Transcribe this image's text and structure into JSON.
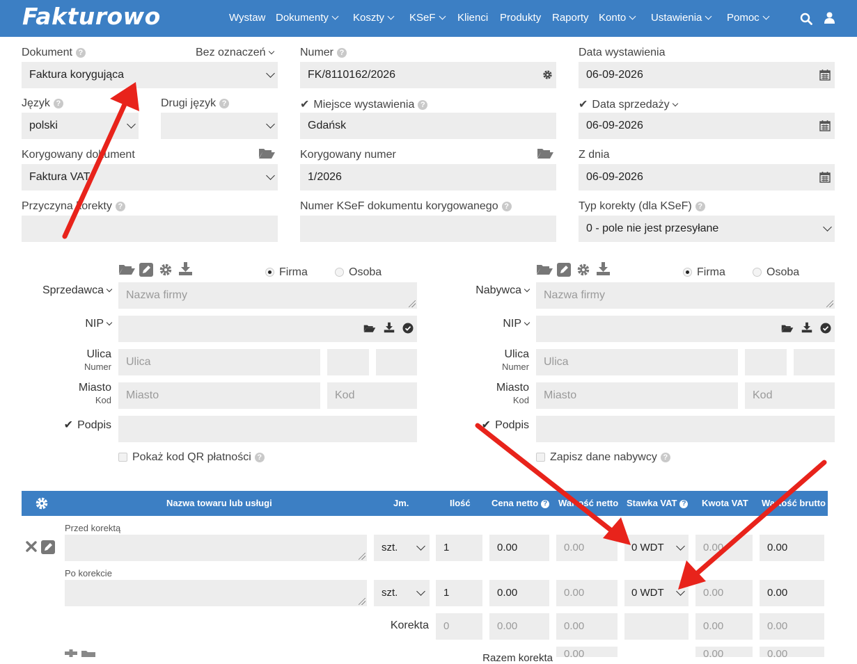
{
  "app": {
    "logo": "Fakturowo"
  },
  "nav": {
    "items": [
      "Wystaw",
      "Dokumenty",
      "Koszty",
      "KSeF",
      "Klienci",
      "Produkty",
      "Raporty",
      "Konto",
      "Ustawienia",
      "Pomoc"
    ]
  },
  "header": {
    "dokument_label": "Dokument",
    "bez_oznaczen": "Bez oznaczeń",
    "dokument_value": "Faktura korygująca",
    "numer_label": "Numer",
    "numer_value": "FK/8110162/2026",
    "data_wyst_label": "Data wystawienia",
    "data_wyst_value": "06-09-2026",
    "jezyk_label": "Język",
    "jezyk_value": "polski",
    "drugi_jezyk_label": "Drugi język",
    "drugi_jezyk_value": "",
    "miejsce_label": "Miejsce wystawienia",
    "miejsce_value": "Gdańsk",
    "data_sprz_label": "Data sprzedaży",
    "data_sprz_value": "06-09-2026",
    "kor_dok_label": "Korygowany dokument",
    "kor_dok_value": "Faktura VAT",
    "kor_num_label": "Korygowany numer",
    "kor_num_value": "1/2026",
    "z_dnia_label": "Z dnia",
    "z_dnia_value": "06-09-2026",
    "przyczyna_label": "Przyczyna korekty",
    "przyczyna_value": "",
    "ksef_num_label": "Numer KSeF dokumentu korygowanego",
    "ksef_num_value": "",
    "typ_kor_label": "Typ korekty (dla KSeF)",
    "typ_kor_value": "0 - pole nie jest przesyłane"
  },
  "seller": {
    "title": "Sprzedawca",
    "firma": "Firma",
    "osoba": "Osoba",
    "nazwa_ph": "Nazwa firmy",
    "nip": "NIP",
    "ulica": "Ulica",
    "numer": "Numer",
    "ulica_ph": "Ulica",
    "miasto": "Miasto",
    "kod": "Kod",
    "miasto_ph": "Miasto",
    "kod_ph": "Kod",
    "podpis": "Podpis",
    "qr": "Pokaż kod QR płatności"
  },
  "buyer": {
    "title": "Nabywca",
    "firma": "Firma",
    "osoba": "Osoba",
    "nazwa_ph": "Nazwa firmy",
    "nip": "NIP",
    "ulica": "Ulica",
    "numer": "Numer",
    "ulica_ph": "Ulica",
    "miasto": "Miasto",
    "kod": "Kod",
    "miasto_ph": "Miasto",
    "kod_ph": "Kod",
    "podpis": "Podpis",
    "zapisz": "Zapisz dane nabywcy"
  },
  "table": {
    "headers": {
      "name": "Nazwa towaru lub usługi",
      "jm": "Jm.",
      "ilosc": "Ilość",
      "cena": "Cena netto",
      "wartosc_netto": "Wartość netto",
      "stawka": "Stawka VAT",
      "kwota": "Kwota VAT",
      "brutto": "Wartość brutto"
    },
    "przed_label": "Przed korektą",
    "po_label": "Po korekcie",
    "przed": {
      "jm": "szt.",
      "ilosc": "1",
      "cena": "0.00",
      "netto": "0.00",
      "stawka": "0 WDT",
      "kwota": "0.00",
      "brutto": "0.00"
    },
    "po": {
      "jm": "szt.",
      "ilosc": "1",
      "cena": "0.00",
      "netto": "0.00",
      "stawka": "0 WDT",
      "kwota": "0.00",
      "brutto": "0.00"
    },
    "korekta_label": "Korekta",
    "korekta": {
      "ilosc": "0",
      "cena": "0.00",
      "netto": "0.00",
      "kwota": "0.00",
      "brutto": "0.00"
    },
    "bottom_label": "Razem korekta",
    "bottom": {
      "netto": "0.00",
      "kwota": "0.00",
      "brutto": "0.00"
    }
  },
  "colors": {
    "brand": "#3c7fc4",
    "field": "#ededed",
    "annotation": "#e8231b"
  }
}
